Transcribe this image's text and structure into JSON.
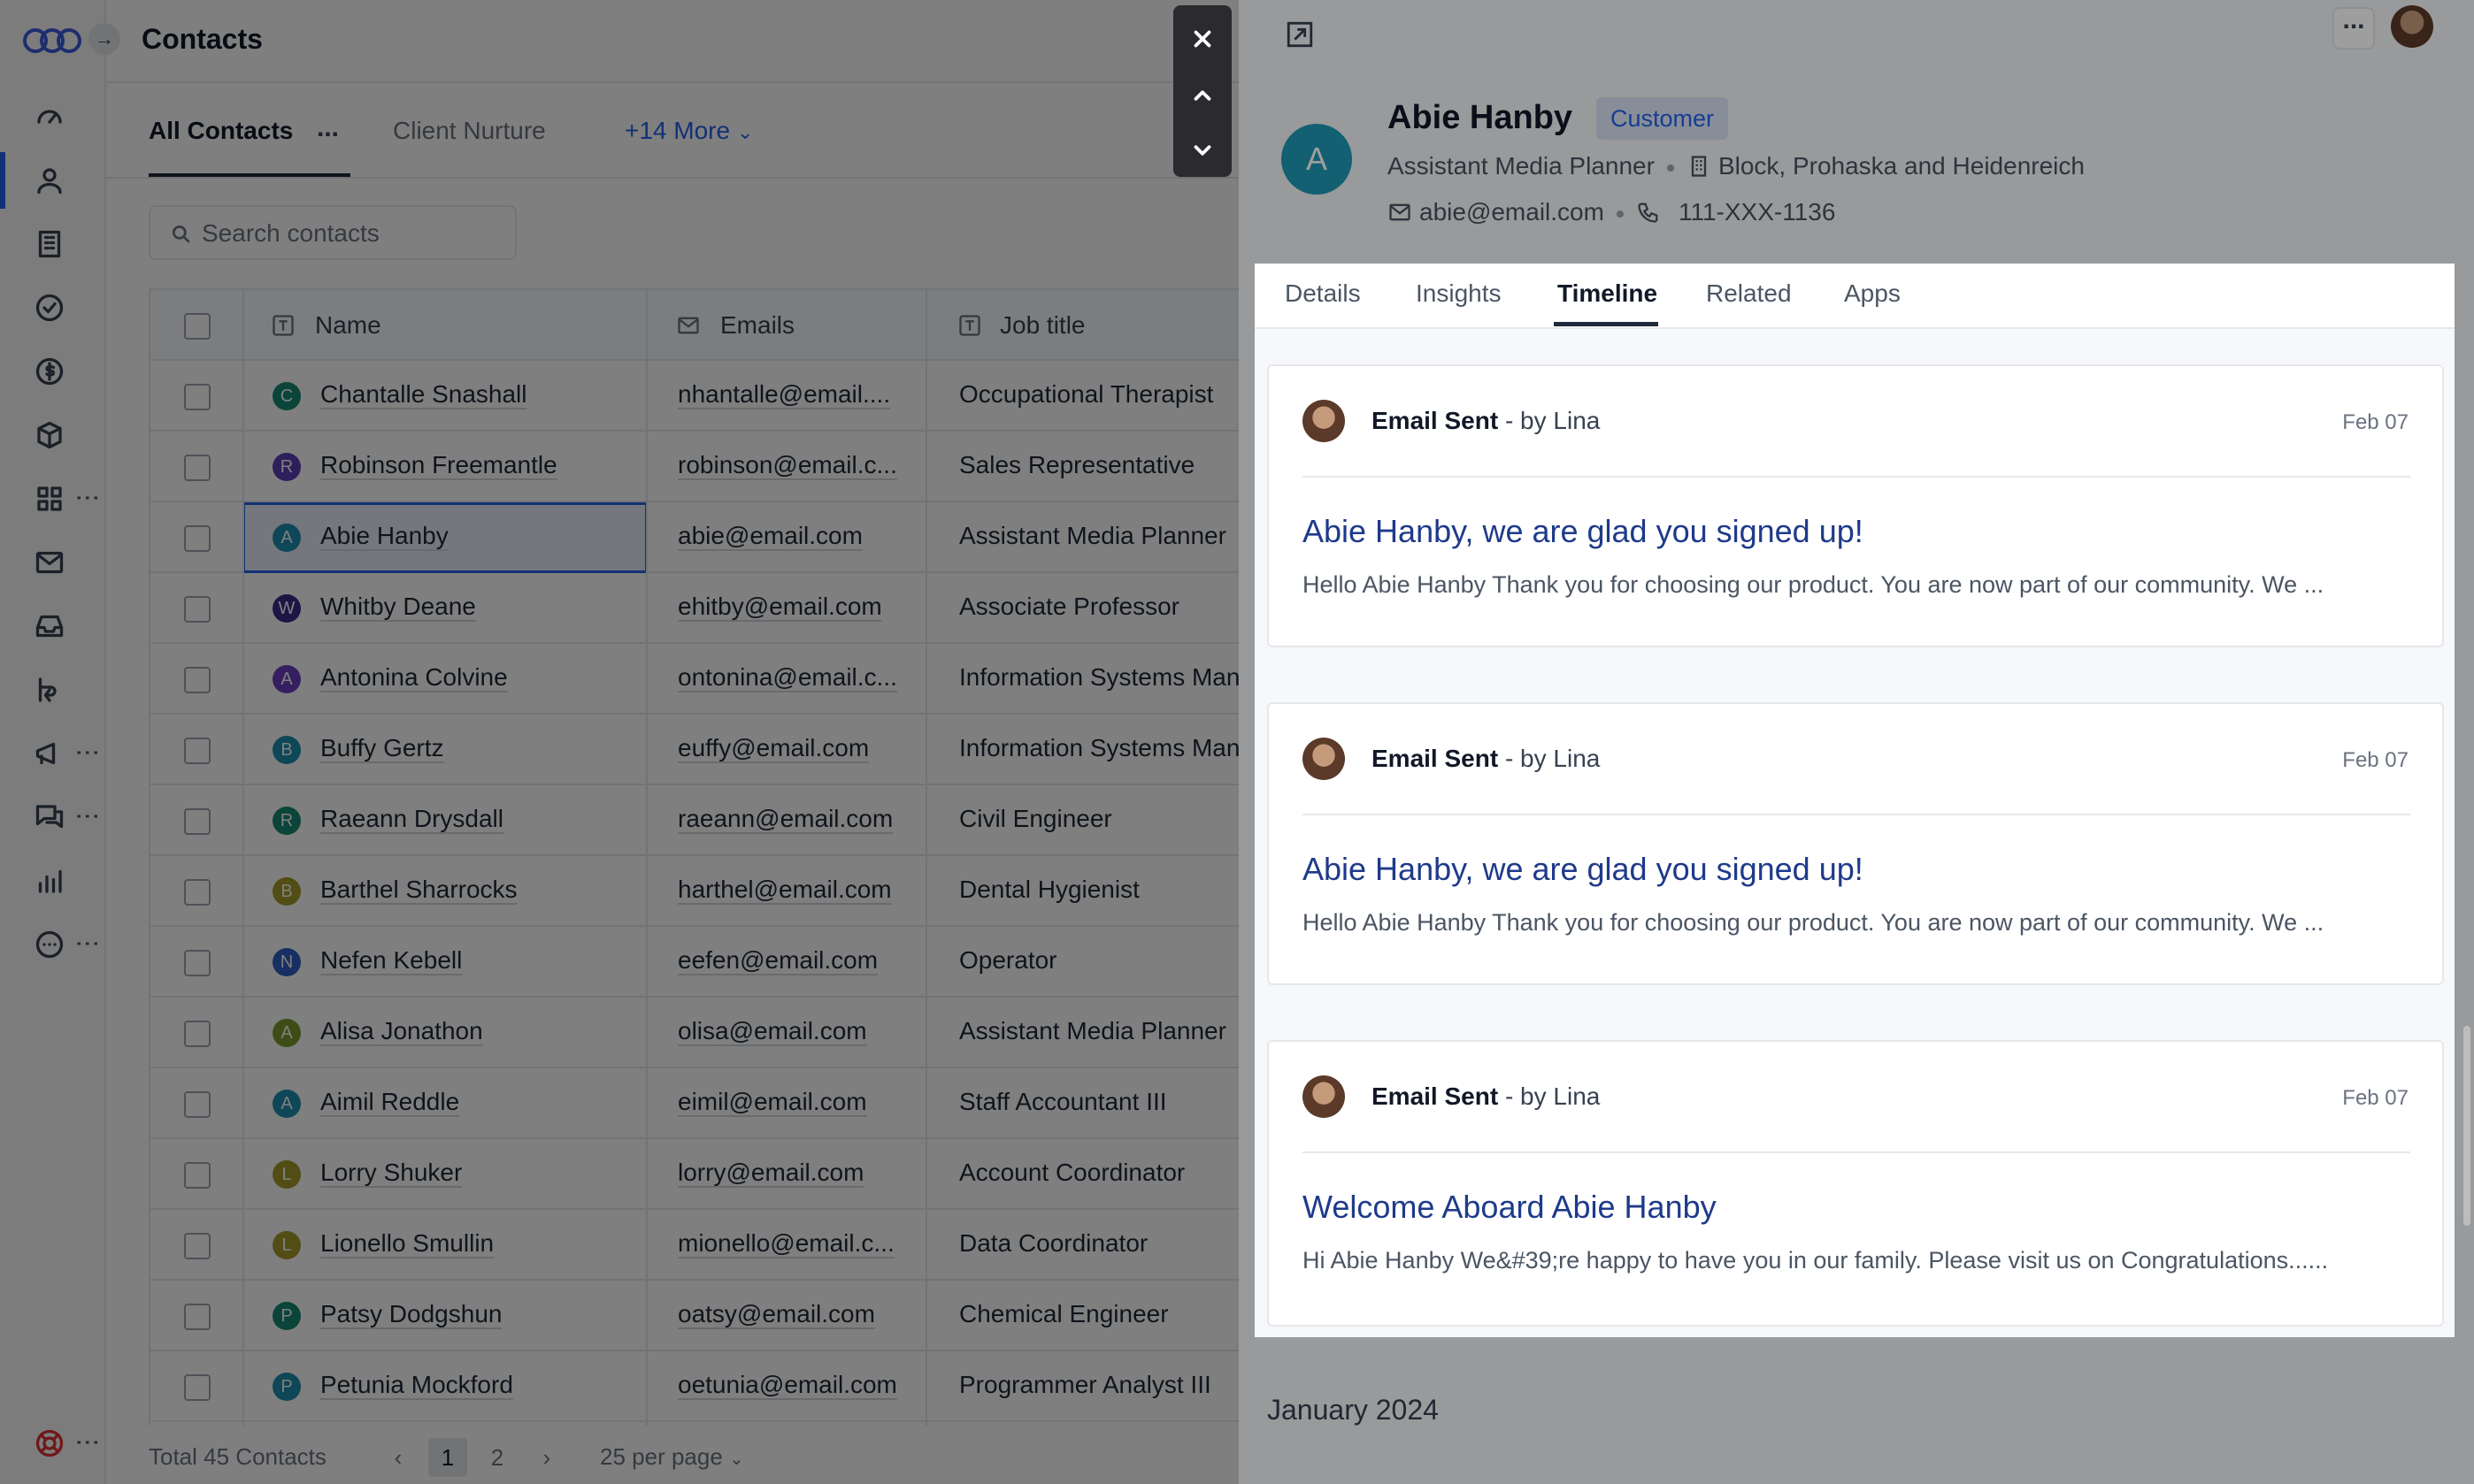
{
  "page": {
    "title": "Contacts"
  },
  "views": {
    "tabs": [
      {
        "label": "All Contacts",
        "active": true
      },
      {
        "label": "Client Nurture",
        "active": false
      }
    ],
    "more_label": "+14 More",
    "options_label": "..."
  },
  "search": {
    "placeholder": "Search contacts"
  },
  "table": {
    "columns": [
      "Name",
      "Emails",
      "Job title"
    ],
    "rows": [
      {
        "initial": "C",
        "color": "#168a72",
        "name": "Chantalle Snashall",
        "email": "nhantalle@email....",
        "job": "Occupational Therapist"
      },
      {
        "initial": "R",
        "color": "#5b3fb8",
        "name": "Robinson Freemantle",
        "email": "robinson@email.c...",
        "job": "Sales Representative"
      },
      {
        "initial": "A",
        "color": "#1d8fae",
        "name": "Abie Hanby",
        "email": "abie@email.com",
        "job": "Assistant Media Planner",
        "selected": true
      },
      {
        "initial": "W",
        "color": "#3b2a8c",
        "name": "Whitby Deane",
        "email": "ehitby@email.com",
        "job": "Associate Professor"
      },
      {
        "initial": "A",
        "color": "#6b3fc2",
        "name": "Antonina Colvine",
        "email": "ontonina@email.c...",
        "job": "Information Systems Man"
      },
      {
        "initial": "B",
        "color": "#1d8fae",
        "name": "Buffy Gertz",
        "email": "euffy@email.com",
        "job": "Information Systems Man"
      },
      {
        "initial": "R",
        "color": "#168a72",
        "name": "Raeann Drysdall",
        "email": "raeann@email.com",
        "job": "Civil Engineer"
      },
      {
        "initial": "B",
        "color": "#a39a2a",
        "name": "Barthel Sharrocks",
        "email": "harthel@email.com",
        "job": "Dental Hygienist"
      },
      {
        "initial": "N",
        "color": "#2f5fc4",
        "name": "Nefen Kebell",
        "email": "eefen@email.com",
        "job": "Operator"
      },
      {
        "initial": "A",
        "color": "#7a9a2a",
        "name": "Alisa Jonathon",
        "email": "olisa@email.com",
        "job": "Assistant Media Planner"
      },
      {
        "initial": "A",
        "color": "#1d8fae",
        "name": "Aimil Reddle",
        "email": "eimil@email.com",
        "job": "Staff Accountant III"
      },
      {
        "initial": "L",
        "color": "#a39a2a",
        "name": "Lorry Shuker",
        "email": "lorry@email.com",
        "job": "Account Coordinator"
      },
      {
        "initial": "L",
        "color": "#a39a2a",
        "name": "Lionello Smullin",
        "email": "mionello@email.c...",
        "job": "Data Coordinator"
      },
      {
        "initial": "P",
        "color": "#168a72",
        "name": "Patsy Dodgshun",
        "email": "oatsy@email.com",
        "job": "Chemical Engineer"
      },
      {
        "initial": "P",
        "color": "#1d8fae",
        "name": "Petunia Mockford",
        "email": "oetunia@email.com",
        "job": "Programmer Analyst III"
      }
    ]
  },
  "footer": {
    "total": "Total 45 Contacts",
    "pages": [
      "1",
      "2"
    ],
    "current_page": "1",
    "per_page": "25 per page"
  },
  "drawer": {
    "contact": {
      "initial": "A",
      "name": "Abie Hanby",
      "badge": "Customer",
      "job_title": "Assistant Media Planner",
      "company": "Block, Prohaska and Heidenreich",
      "email": "abie@email.com",
      "phone": "111-XXX-1136"
    },
    "more_label": "...",
    "tabs": [
      {
        "label": "Details"
      },
      {
        "label": "Insights"
      },
      {
        "label": "Timeline",
        "active": true
      },
      {
        "label": "Related"
      },
      {
        "label": "Apps"
      }
    ],
    "timeline": [
      {
        "event": "Email Sent",
        "by": "- by Lina",
        "date": "Feb 07",
        "subject": "Abie Hanby, we are glad you signed up!",
        "preview": "Hello Abie Hanby Thank you for choosing our product. You are now part of our community. We ..."
      },
      {
        "event": "Email Sent",
        "by": "- by Lina",
        "date": "Feb 07",
        "subject": "Abie Hanby, we are glad you signed up!",
        "preview": "Hello Abie Hanby Thank you for choosing our product. You are now part of our community. We ..."
      },
      {
        "event": "Email Sent",
        "by": "- by Lina",
        "date": "Feb 07",
        "subject": "Welcome Aboard Abie Hanby",
        "preview": "Hi Abie Hanby We&#39;re happy to have you in our family. Please visit us on Congratulations......"
      }
    ],
    "month_label": "January 2024"
  },
  "colors": {
    "accent": "#2563eb",
    "customer_badge_bg": "#dbe6f7",
    "contact_avatar": "#1e9bb8"
  }
}
